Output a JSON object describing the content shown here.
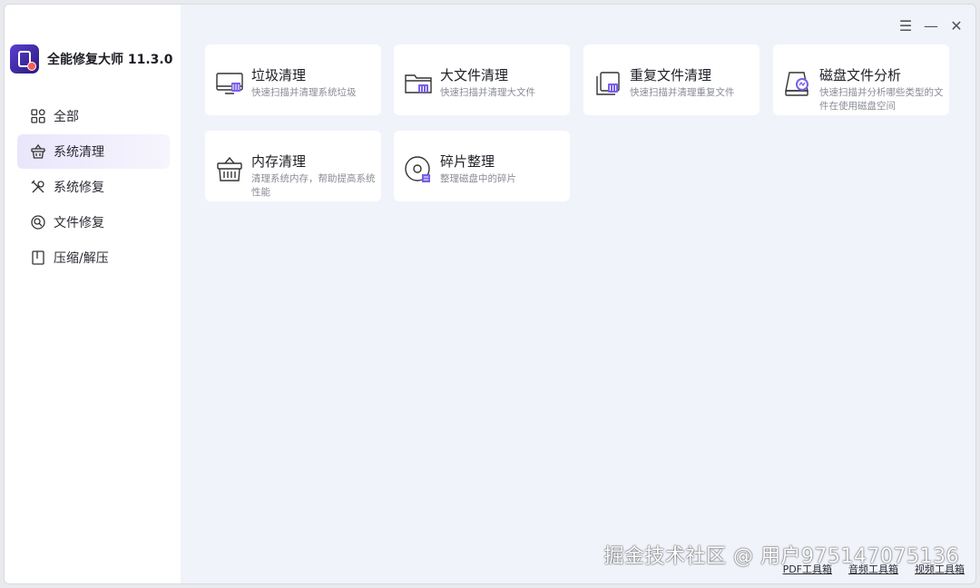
{
  "app": {
    "title": "全能修复大师 11.3.0",
    "accent": "#6a4ee0"
  },
  "window_controls": {
    "menu": "☰",
    "minimize": "—",
    "close": "✕"
  },
  "sidebar": {
    "items": [
      {
        "label": "全部",
        "icon": "grid-icon"
      },
      {
        "label": "系统清理",
        "icon": "broom-basket-icon",
        "active": true
      },
      {
        "label": "系统修复",
        "icon": "tools-icon"
      },
      {
        "label": "文件修复",
        "icon": "file-repair-icon"
      },
      {
        "label": "压缩/解压",
        "icon": "archive-icon"
      }
    ]
  },
  "cards": [
    {
      "title": "垃圾清理",
      "desc": "快速扫描并清理系统垃圾",
      "icon": "monitor-clean-icon"
    },
    {
      "title": "大文件清理",
      "desc": "快速扫描并清理大文件",
      "icon": "folder-clean-icon"
    },
    {
      "title": "重复文件清理",
      "desc": "快速扫描并清理重复文件",
      "icon": "duplicate-files-icon"
    },
    {
      "title": "磁盘文件分析",
      "desc": "快速扫描并分析哪些类型的文件在使用磁盘空间",
      "icon": "disk-analysis-icon"
    },
    {
      "title": "内存清理",
      "desc": "清理系统内存，帮助提高系统性能",
      "icon": "memory-clean-icon"
    },
    {
      "title": "碎片整理",
      "desc": "整理磁盘中的碎片",
      "icon": "defrag-icon"
    }
  ],
  "footer": {
    "links": [
      "PDF工具箱",
      "音频工具箱",
      "视频工具箱"
    ]
  },
  "watermark": "掘金技术社区 @ 用户975147075136"
}
